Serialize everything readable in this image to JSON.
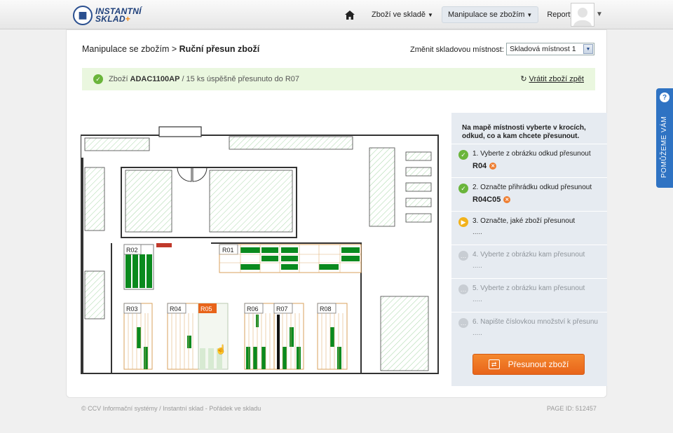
{
  "app": {
    "logo_line1": "INSTANTNÍ",
    "logo_line2": "SKLAD",
    "logo_plus": "+"
  },
  "nav": {
    "items": [
      {
        "label": "Zboží ve skladě"
      },
      {
        "label": "Manipulace se zbožím"
      },
      {
        "label": "Reporty"
      }
    ]
  },
  "breadcrumb": {
    "parent": "Manipulace se zbožím",
    "separator": ">",
    "current": "Ruční přesun zboží"
  },
  "room": {
    "label": "Změnit skladovou místnost:",
    "selected": "Skladová místnost 1"
  },
  "alert": {
    "prefix": "Zboží",
    "code": "ADAC1100AP",
    "message": "/ 15 ks úspěšně přesunuto do R07",
    "undo_label": "Vrátit zboží zpět"
  },
  "map": {
    "racks": [
      "R01",
      "R02",
      "R03",
      "R04",
      "R05",
      "R06",
      "R07",
      "R08"
    ],
    "selected_rack": "R05"
  },
  "steps": {
    "intro": "Na mapě místnosti vyberte v krocích, odkud, co a kam chcete přesunout.",
    "items": [
      {
        "text": "1. Vyberte z obrázku odkud přesunout",
        "value": "R04",
        "status": "done"
      },
      {
        "text": "2. Označte přihrádku odkud přesunout",
        "value": "R04C05",
        "status": "done"
      },
      {
        "text": "3. Označte, jaké zboží přesunout",
        "value": ".....",
        "status": "current"
      },
      {
        "text": "4. Vyberte z obrázku kam přesunout",
        "value": ".....",
        "status": "todo"
      },
      {
        "text": "5. Vyberte z obrázku kam přesunout",
        "value": ".....",
        "status": "todo"
      },
      {
        "text": "6. Napište číslovkou množství k přesunu",
        "value": ".....",
        "status": "todo"
      }
    ],
    "button_label": "Přesunout zboží"
  },
  "footer": {
    "left": "© CCV Informační systémy / Instantní sklad - Pořádek ve skladu",
    "right": "PAGE ID: 512457"
  },
  "help": {
    "label": "POMŮŽEME VÁM",
    "icon": "?"
  },
  "colors": {
    "accent": "#2f73c3",
    "success": "#6ab53b",
    "orange": "#e8641a",
    "rack_green": "#0a8a1e"
  }
}
